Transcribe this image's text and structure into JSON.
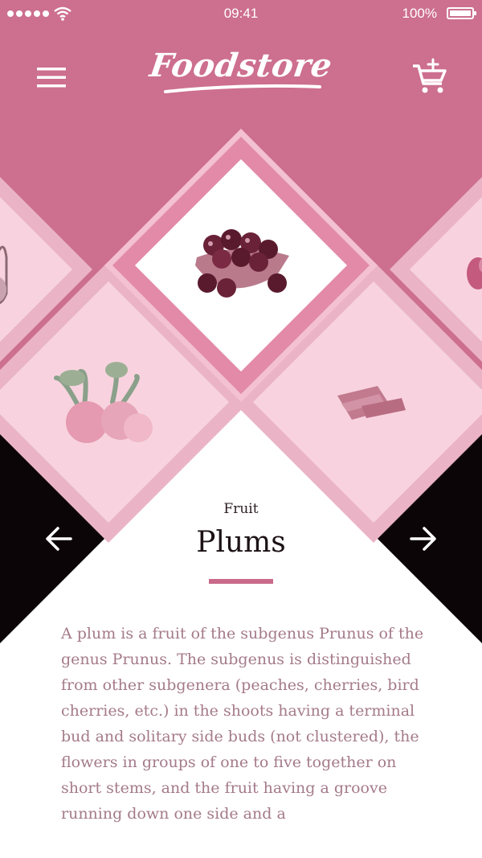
{
  "status_bar": {
    "time": "09:41",
    "battery": "100%"
  },
  "header": {
    "logo": "Foodstore",
    "menu_icon": "hamburger-menu-icon",
    "cart_icon": "cart-add-icon"
  },
  "carousel": {
    "items": [
      {
        "name": "basket",
        "image": "basket-of-produce-image"
      },
      {
        "name": "plums",
        "image": "plums-bowl-image"
      },
      {
        "name": "fruit-right",
        "image": "red-fruit-image"
      },
      {
        "name": "radishes",
        "image": "radishes-image"
      },
      {
        "name": "wafers",
        "image": "wafer-bars-image"
      }
    ],
    "prev_icon": "arrow-left-icon",
    "next_icon": "arrow-right-icon"
  },
  "product": {
    "category": "Fruit",
    "title": "Plums",
    "description": "A plum is a fruit of the subgenus Prunus of the genus Prunus. The subgenus is distinguished from other subgenera (peaches, cherries, bird cherries, etc.) in the shoots having a terminal bud and solitary side buds (not clustered), the flowers in groups of one to five together on short stems, and the fruit having a groove running down one side and a"
  },
  "colors": {
    "header_pink": "#cd6f8f",
    "light_pink": "#f8d3df",
    "mid_pink": "#eab4c6",
    "accent": "#c96a8b",
    "black": "#0c0507",
    "text": "#a47a8a"
  }
}
